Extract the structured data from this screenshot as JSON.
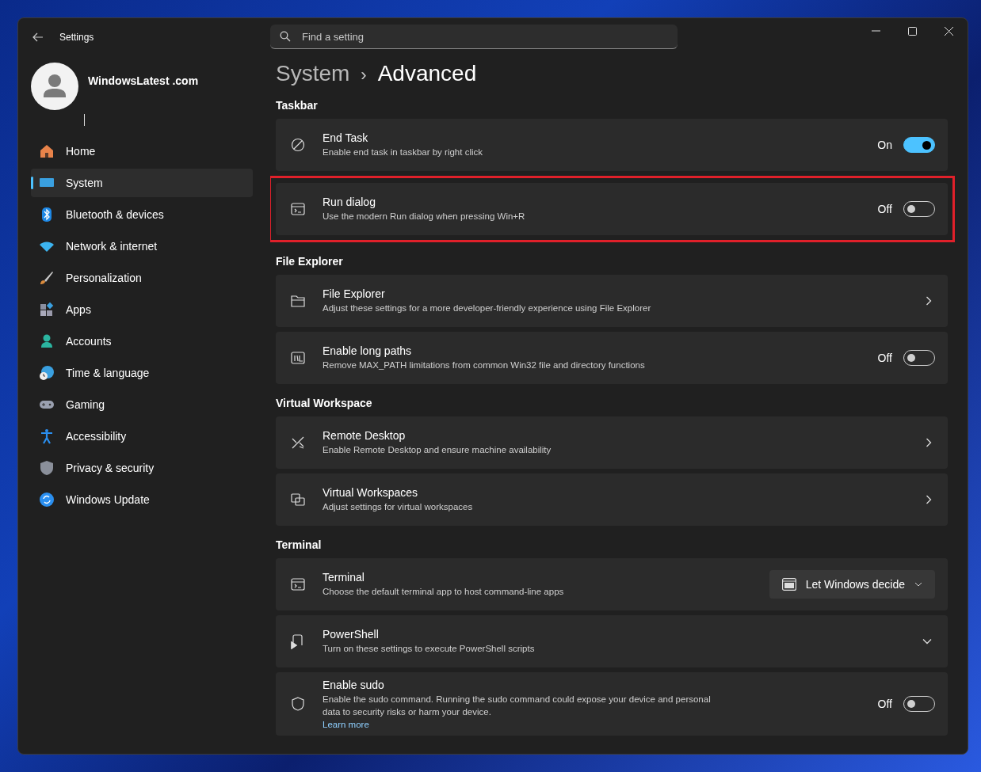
{
  "window": {
    "title": "Settings"
  },
  "search": {
    "placeholder": "Find a setting"
  },
  "account": {
    "name": "WindowsLatest .com"
  },
  "sidebar": {
    "items": [
      {
        "label": "Home",
        "selected": false
      },
      {
        "label": "System",
        "selected": true
      },
      {
        "label": "Bluetooth & devices",
        "selected": false
      },
      {
        "label": "Network & internet",
        "selected": false
      },
      {
        "label": "Personalization",
        "selected": false
      },
      {
        "label": "Apps",
        "selected": false
      },
      {
        "label": "Accounts",
        "selected": false
      },
      {
        "label": "Time & language",
        "selected": false
      },
      {
        "label": "Gaming",
        "selected": false
      },
      {
        "label": "Accessibility",
        "selected": false
      },
      {
        "label": "Privacy & security",
        "selected": false
      },
      {
        "label": "Windows Update",
        "selected": false
      }
    ]
  },
  "breadcrumb": {
    "parent": "System",
    "separator": "›",
    "current": "Advanced"
  },
  "sections": [
    {
      "title": "Taskbar",
      "items": [
        {
          "kind": "toggle",
          "title": "End Task",
          "description": "Enable end task in taskbar by right click",
          "state_label": "On",
          "on": true,
          "highlighted": false
        },
        {
          "kind": "toggle",
          "title": "Run dialog",
          "description": "Use the modern Run dialog when pressing Win+R",
          "state_label": "Off",
          "on": false,
          "highlighted": true
        }
      ]
    },
    {
      "title": "File Explorer",
      "items": [
        {
          "kind": "link",
          "title": "File Explorer",
          "description": "Adjust these settings for a more developer-friendly experience using File Explorer",
          "highlighted": false
        },
        {
          "kind": "toggle",
          "title": "Enable long paths",
          "description": "Remove MAX_PATH limitations from common Win32 file and directory functions",
          "state_label": "Off",
          "on": false,
          "highlighted": false
        }
      ]
    },
    {
      "title": "Virtual Workspace",
      "items": [
        {
          "kind": "link",
          "title": "Remote Desktop",
          "description": "Enable Remote Desktop and ensure machine availability",
          "highlighted": false
        },
        {
          "kind": "link",
          "title": "Virtual Workspaces",
          "description": "Adjust settings for virtual workspaces",
          "highlighted": false
        }
      ]
    },
    {
      "title": "Terminal",
      "items": [
        {
          "kind": "dropdown",
          "title": "Terminal",
          "description": "Choose the default terminal app to host command-line apps",
          "value": "Let Windows decide",
          "highlighted": false
        },
        {
          "kind": "expand",
          "title": "PowerShell",
          "description": "Turn on these settings to execute PowerShell scripts",
          "highlighted": false
        },
        {
          "kind": "toggle",
          "title": "Enable sudo",
          "description": "Enable the sudo command. Running the sudo command could expose your device and personal data to security risks or harm your device.",
          "link": "Learn more",
          "state_label": "Off",
          "on": false,
          "highlighted": false
        }
      ]
    }
  ]
}
